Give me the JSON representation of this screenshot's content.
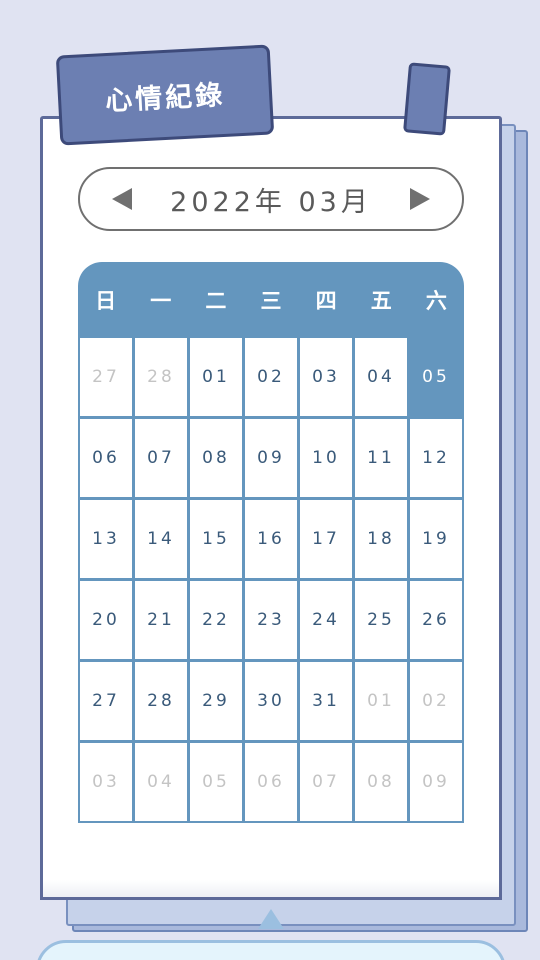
{
  "header": {
    "title": "心情紀錄"
  },
  "month_nav": {
    "label": "2022年 03月",
    "prev_icon": "triangle-left-icon",
    "next_icon": "triangle-right-icon"
  },
  "calendar": {
    "weekdays": [
      "日",
      "一",
      "二",
      "三",
      "四",
      "五",
      "六"
    ],
    "days": [
      {
        "label": "27",
        "state": "other"
      },
      {
        "label": "28",
        "state": "other"
      },
      {
        "label": "01",
        "state": "current"
      },
      {
        "label": "02",
        "state": "current"
      },
      {
        "label": "03",
        "state": "current"
      },
      {
        "label": "04",
        "state": "current"
      },
      {
        "label": "05",
        "state": "selected"
      },
      {
        "label": "06",
        "state": "current"
      },
      {
        "label": "07",
        "state": "current"
      },
      {
        "label": "08",
        "state": "current"
      },
      {
        "label": "09",
        "state": "current"
      },
      {
        "label": "10",
        "state": "current"
      },
      {
        "label": "11",
        "state": "current"
      },
      {
        "label": "12",
        "state": "current"
      },
      {
        "label": "13",
        "state": "current"
      },
      {
        "label": "14",
        "state": "current"
      },
      {
        "label": "15",
        "state": "current"
      },
      {
        "label": "16",
        "state": "current"
      },
      {
        "label": "17",
        "state": "current"
      },
      {
        "label": "18",
        "state": "current"
      },
      {
        "label": "19",
        "state": "current"
      },
      {
        "label": "20",
        "state": "current"
      },
      {
        "label": "21",
        "state": "current"
      },
      {
        "label": "22",
        "state": "current"
      },
      {
        "label": "23",
        "state": "current"
      },
      {
        "label": "24",
        "state": "current"
      },
      {
        "label": "25",
        "state": "current"
      },
      {
        "label": "26",
        "state": "current"
      },
      {
        "label": "27",
        "state": "current"
      },
      {
        "label": "28",
        "state": "current"
      },
      {
        "label": "29",
        "state": "current"
      },
      {
        "label": "30",
        "state": "current"
      },
      {
        "label": "31",
        "state": "current"
      },
      {
        "label": "01",
        "state": "other"
      },
      {
        "label": "02",
        "state": "other"
      },
      {
        "label": "03",
        "state": "other"
      },
      {
        "label": "04",
        "state": "other"
      },
      {
        "label": "05",
        "state": "other"
      },
      {
        "label": "06",
        "state": "other"
      },
      {
        "label": "07",
        "state": "other"
      },
      {
        "label": "08",
        "state": "other"
      },
      {
        "label": "09",
        "state": "other"
      }
    ]
  },
  "colors": {
    "background": "#e0e3f2",
    "tab": "#6c7fb2",
    "calendar_accent": "#6496be",
    "day_text": "#3a5a7a",
    "muted_day_text": "#c4c4c4"
  }
}
